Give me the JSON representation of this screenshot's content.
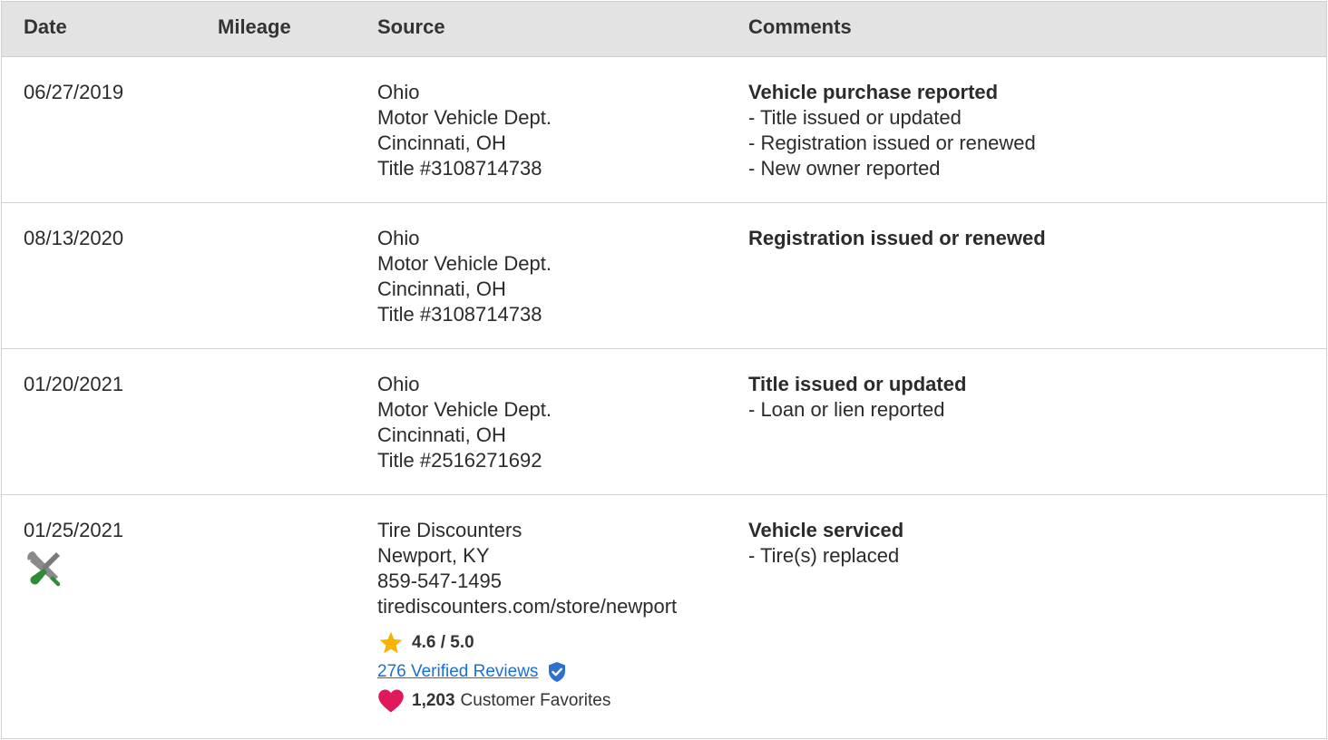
{
  "headers": {
    "date": "Date",
    "mileage": "Mileage",
    "source": "Source",
    "comments": "Comments"
  },
  "rows": [
    {
      "date": "06/27/2019",
      "mileage": "",
      "source": [
        "Ohio",
        "Motor Vehicle Dept.",
        "Cincinnati, OH",
        "Title #3108714738"
      ],
      "comment_title": "Vehicle purchase reported",
      "comment_items": [
        "- Title issued or updated",
        "- Registration issued or renewed",
        "- New owner reported"
      ]
    },
    {
      "date": "08/13/2020",
      "mileage": "",
      "source": [
        "Ohio",
        "Motor Vehicle Dept.",
        "Cincinnati, OH",
        "Title #3108714738"
      ],
      "comment_title": "Registration issued or renewed",
      "comment_items": []
    },
    {
      "date": "01/20/2021",
      "mileage": "",
      "source": [
        "Ohio",
        "Motor Vehicle Dept.",
        "Cincinnati, OH",
        "Title #2516271692"
      ],
      "comment_title": "Title issued or updated",
      "comment_items": [
        "- Loan or lien reported"
      ]
    },
    {
      "date": "01/25/2021",
      "mileage": "",
      "icon": "service-tools-icon",
      "source": [
        "Tire Discounters",
        "Newport, KY",
        "859-547-1495",
        "tirediscounters.com/store/newport"
      ],
      "rating": {
        "value": "4.6 / 5.0",
        "reviews_link": "276 Verified Reviews",
        "favorites_count": "1,203",
        "favorites_label": "Customer Favorites"
      },
      "comment_title": "Vehicle serviced",
      "comment_items": [
        "- Tire(s) replaced"
      ]
    }
  ],
  "colors": {
    "header_bg": "#e3e3e3",
    "link": "#1a6fd6",
    "star": "#f5b400",
    "heart": "#e0185c",
    "verified": "#2f6fce",
    "wrench_green": "#2e8b3a"
  }
}
